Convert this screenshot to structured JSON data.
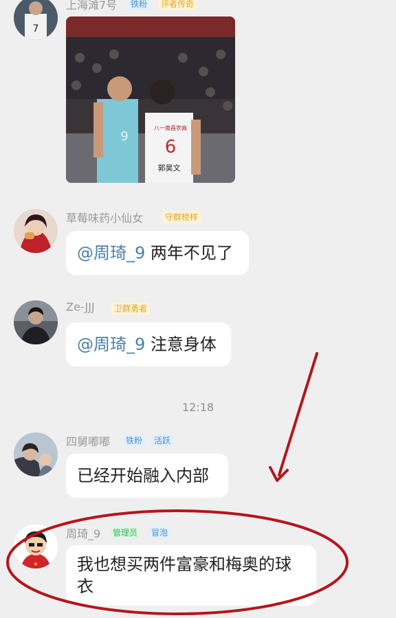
{
  "messages": [
    {
      "name": "上海滩7号",
      "badges": [
        "铁粉",
        "评者传奇"
      ]
    },
    {
      "name": "草莓味药小仙女",
      "badges": [
        "守群榜样"
      ],
      "mention": "@周琦_9",
      "text": " 两年不见了"
    },
    {
      "name": "Ze-JJJ",
      "badges": [
        "卫群勇者"
      ],
      "mention": "@周琦_9",
      "text": " 注意身体"
    },
    {
      "name": "四舅嘟嘟",
      "badges": [
        "铁粉",
        "活跃"
      ],
      "text": "已经开始融入内部"
    },
    {
      "name": "周琦_9",
      "badges": [
        "管理员",
        "冒泡"
      ],
      "text_line1": "我也想买两件富豪和梅奥的球",
      "text_line2": "衣"
    }
  ],
  "time": "12:18",
  "photo": {
    "jersey_left": "9",
    "jersey_right": "6",
    "team_right": "八一南昌农商",
    "name_right": "郭昊文"
  },
  "colors": {
    "annotation_red": "#b4161b",
    "mention": "#4a7fa8"
  }
}
